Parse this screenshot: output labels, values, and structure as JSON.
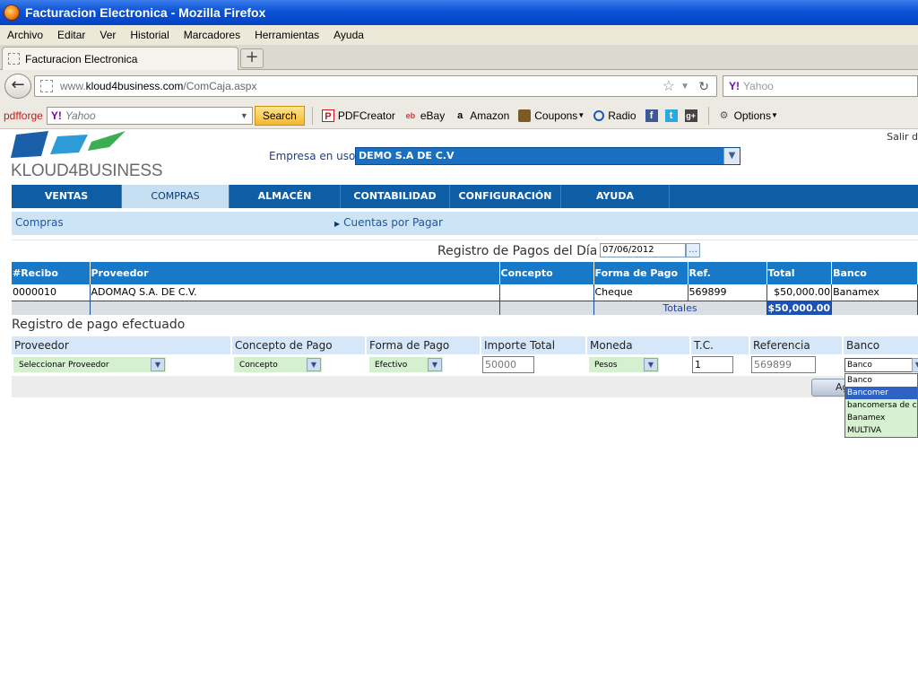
{
  "window": {
    "title": "Facturacion Electronica - Mozilla Firefox"
  },
  "menu": [
    "Archivo",
    "Editar",
    "Ver",
    "Historial",
    "Marcadores",
    "Herramientas",
    "Ayuda"
  ],
  "tab": {
    "label": "Facturacion Electronica",
    "new_tab": "+"
  },
  "address": {
    "prefix": "www.",
    "host": "kloud4business.com",
    "path": "/ComCaja.aspx"
  },
  "browser_search": {
    "placeholder": "Yahoo",
    "logo": "Y!"
  },
  "toolbar": {
    "brand": "pdfforge",
    "search_placeholder": "Yahoo",
    "search_logo": "Y!",
    "search_button": "Search",
    "items": [
      "PDFCreator",
      "eBay",
      "Amazon",
      "Coupons",
      "Radio"
    ],
    "options": "Options"
  },
  "header": {
    "logo_text": "KLOUD4BUSINESS",
    "logout": "Salir d",
    "empresa_label": "Empresa en uso:",
    "empresa_value": "DEMO S.A DE C.V"
  },
  "nav": [
    "VENTAS",
    "COMPRAS",
    "ALMACÉN",
    "CONTABILIDAD",
    "CONFIGURACIÓN",
    "AYUDA"
  ],
  "nav_active": "COMPRAS",
  "subnav": {
    "left": "Compras",
    "right": "Cuentas por Pagar"
  },
  "registro": {
    "title": "Registro de Pagos del Día",
    "date": "07/06/2012"
  },
  "table": {
    "headers": [
      "#Recibo",
      "Proveedor",
      "Concepto",
      "Forma de Pago",
      "Ref.",
      "Total",
      "Banco"
    ],
    "rows": [
      [
        "0000010",
        "ADOMAQ S.A. DE C.V.",
        "",
        "Cheque",
        "569899",
        "$50,000.00",
        "Banamex"
      ]
    ],
    "totals_label": "Totales",
    "totals_value": "$50,000.00"
  },
  "form": {
    "title": "Registro de pago efectuado",
    "headers": [
      "Proveedor",
      "Concepto de Pago",
      "Forma de Pago",
      "Importe Total",
      "Moneda",
      "T.C.",
      "Referencia",
      "Banco"
    ],
    "proveedor": "Seleccionar Proveedor",
    "concepto": "Concepto",
    "forma_pago": "Efectivo",
    "importe": "50000",
    "moneda": "Pesos",
    "tc": "1",
    "referencia": "569899",
    "banco": "Banco",
    "agregar": "Agregar"
  },
  "banco_options": [
    "Banco",
    "Bancomer",
    "bancomersa de cv",
    "Banamex",
    "MULTIVA"
  ],
  "banco_highlighted": "Bancomer",
  "colors": {
    "nav_bg": "#0e5ea5",
    "header_blue": "#1779c8",
    "subnav_bg": "#cde4f7",
    "select_green": "#d4f0cf"
  }
}
